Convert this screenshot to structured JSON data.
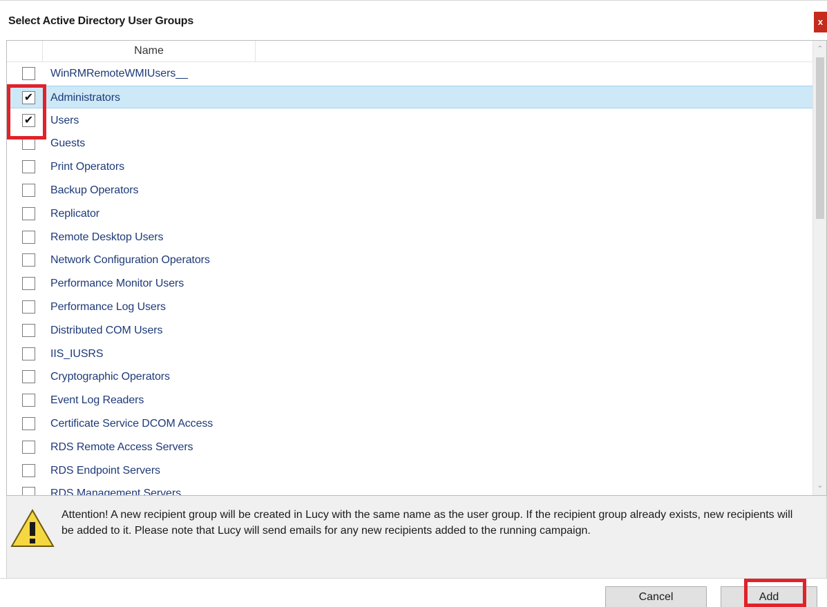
{
  "dialog": {
    "title": "Select Active Directory User Groups",
    "close_label": "x"
  },
  "grid": {
    "column_header": "Name",
    "rows": [
      {
        "label": "WinRMRemoteWMIUsers__",
        "checked": false,
        "selected": false
      },
      {
        "label": "Administrators",
        "checked": true,
        "selected": true
      },
      {
        "label": "Users",
        "checked": true,
        "selected": false
      },
      {
        "label": "Guests",
        "checked": false,
        "selected": false
      },
      {
        "label": "Print Operators",
        "checked": false,
        "selected": false
      },
      {
        "label": "Backup Operators",
        "checked": false,
        "selected": false
      },
      {
        "label": "Replicator",
        "checked": false,
        "selected": false
      },
      {
        "label": "Remote Desktop Users",
        "checked": false,
        "selected": false
      },
      {
        "label": "Network Configuration Operators",
        "checked": false,
        "selected": false
      },
      {
        "label": "Performance Monitor Users",
        "checked": false,
        "selected": false
      },
      {
        "label": "Performance Log Users",
        "checked": false,
        "selected": false
      },
      {
        "label": "Distributed COM Users",
        "checked": false,
        "selected": false
      },
      {
        "label": "IIS_IUSRS",
        "checked": false,
        "selected": false
      },
      {
        "label": "Cryptographic Operators",
        "checked": false,
        "selected": false
      },
      {
        "label": "Event Log Readers",
        "checked": false,
        "selected": false
      },
      {
        "label": "Certificate Service DCOM Access",
        "checked": false,
        "selected": false
      },
      {
        "label": "RDS Remote Access Servers",
        "checked": false,
        "selected": false
      },
      {
        "label": "RDS Endpoint Servers",
        "checked": false,
        "selected": false
      },
      {
        "label": "RDS Management Servers",
        "checked": false,
        "selected": false
      }
    ]
  },
  "notice": {
    "icon": "warning-icon",
    "text": "Attention! A new recipient group will be created in Lucy with the same name as the user group. If the recipient group already exists, new recipients will be added to it. Please note that Lucy will send emails for any new recipients added to the running campaign."
  },
  "footer": {
    "cancel_label": "Cancel",
    "add_label": "Add"
  },
  "colors": {
    "selected_row": "#cde8f7",
    "label_text": "#1e3a78",
    "highlight": "#e0222a",
    "close_button": "#c42b1c"
  }
}
